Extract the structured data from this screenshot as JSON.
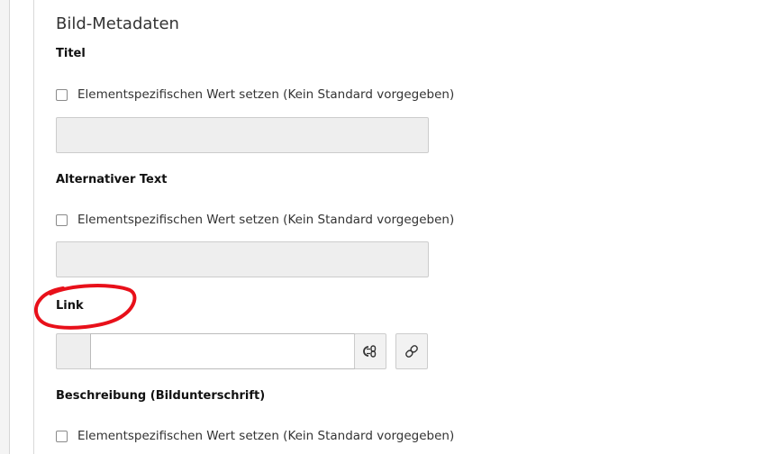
{
  "section": {
    "title": "Bild-Metadaten"
  },
  "fields": {
    "titel": {
      "label": "Titel",
      "checkbox_label": "Elementspezifischen Wert setzen (Kein Standard vorgegeben)",
      "checked": false
    },
    "alternativer_text": {
      "label": "Alternativer Text",
      "checkbox_label": "Elementspezifischen Wert setzen (Kein Standard vorgegeben)",
      "checked": false
    },
    "link": {
      "label": "Link",
      "value": "",
      "highlight_color": "#e8101a",
      "buttons": [
        {
          "icon": "link-browser-icon"
        },
        {
          "icon": "link-icon"
        }
      ]
    },
    "beschreibung": {
      "label": "Beschreibung (Bildunterschrift)",
      "checkbox_label": "Elementspezifischen Wert setzen (Kein Standard vorgegeben)",
      "checked": false
    }
  }
}
